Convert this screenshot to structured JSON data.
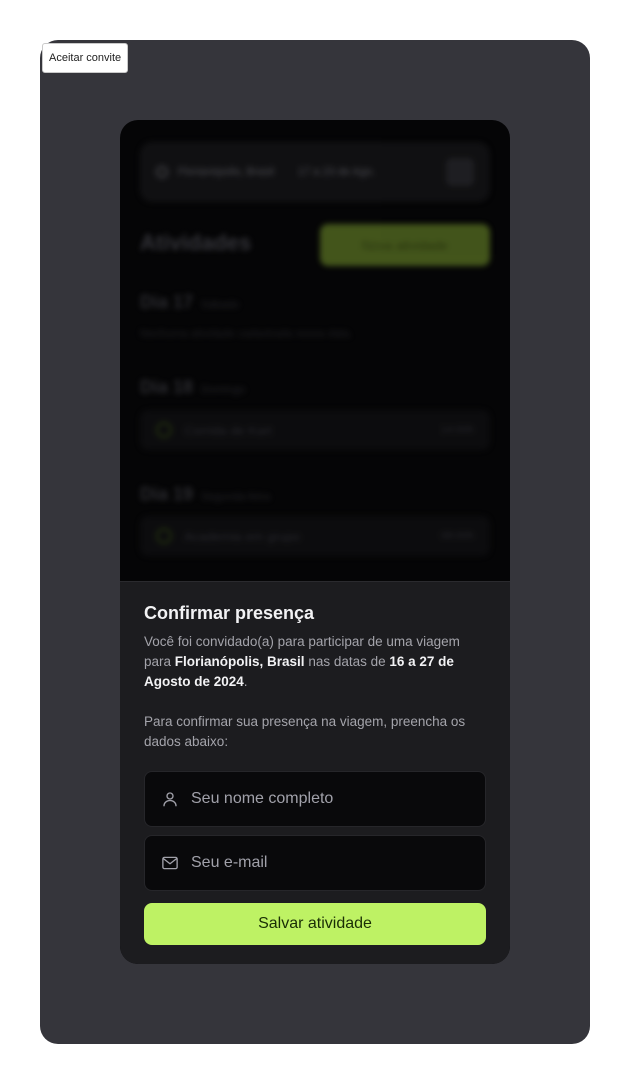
{
  "window": {
    "tab_label": "Aceitar convite"
  },
  "background": {
    "destination": "Florianópolis, Brasil",
    "dates": "17 a 23 de Ago.",
    "section_title": "Atividades",
    "new_activity_label": "Nova atividade",
    "days": [
      {
        "label": "Dia 17",
        "weekday": "Sábado",
        "note": "Nenhuma atividade cadastrada nessa data."
      },
      {
        "label": "Dia 18",
        "weekday": "Domingo",
        "activity": "Corrida de Kart",
        "time": "14:00h"
      },
      {
        "label": "Dia 19",
        "weekday": "Segunda-feira",
        "activity": "Academia em grupo",
        "time": "08:00h"
      }
    ]
  },
  "modal": {
    "title": "Confirmar presença",
    "text_prefix": "Você foi convidado(a) para participar de uma viagem para ",
    "destination": "Florianópolis, Brasil",
    "text_middle": " nas datas de ",
    "date_range": "16 a 27 de Agosto de 2024",
    "text_suffix": ".",
    "instructions": "Para confirmar sua presença na viagem, preencha os dados abaixo:",
    "name_field": {
      "placeholder": "Seu nome completo",
      "value": "",
      "icon": "user-icon"
    },
    "email_field": {
      "placeholder": "Seu e-mail",
      "value": "",
      "icon": "mail-icon"
    },
    "submit_label": "Salvar atividade"
  },
  "colors": {
    "accent": "#bef264",
    "frame": "#35353b",
    "sheet": "#1c1c1f",
    "field": "#09090b"
  }
}
